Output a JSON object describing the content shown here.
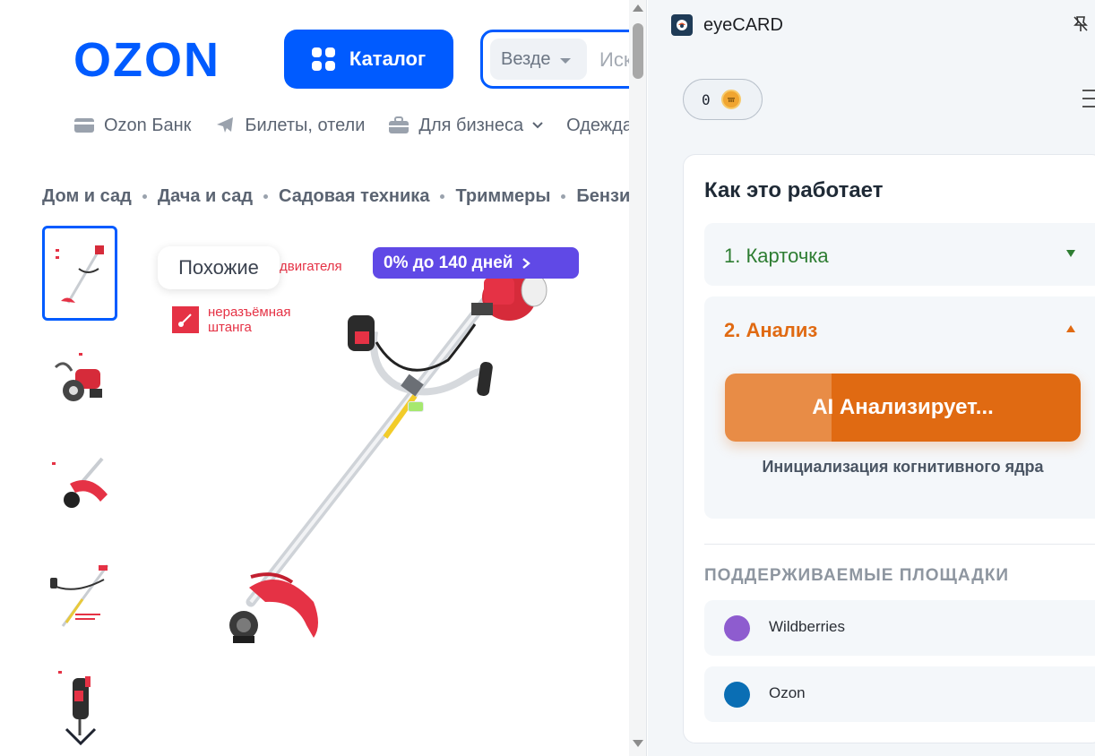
{
  "ozon": {
    "logo_text": "OZON",
    "catalog_label": "Каталог",
    "search": {
      "scope": "Везде",
      "placeholder": "Искать на Ozon"
    },
    "topnav": [
      "Ozon Банк",
      "Билеты, отели",
      "Для бизнеса",
      "Одежда"
    ],
    "breadcrumbs": [
      "Дом и сад",
      "Дача и сад",
      "Садовая техника",
      "Триммеры",
      "Бензиновые триммеры"
    ],
    "similar_label": "Похожие",
    "installment_label": "0% до 140 дней",
    "feature_1": "двигателя",
    "feature_2_line1": "неразъёмная",
    "feature_2_line2": "штанга",
    "brand_color": "#005bff",
    "installment_color": "#6049e6"
  },
  "panel": {
    "app_title": "eyeCARD",
    "coins": "0",
    "section_title": "Как это работает",
    "step1_label": "1. Карточка",
    "step2_label": "2. Анализ",
    "ai_button_label": "AI Анализирует...",
    "status_text": "Инициализация когнитивного ядра",
    "supported_title": "ПОДДЕРЖИВАЕМЫЕ ПЛОЩАДКИ",
    "sites": [
      {
        "name": "Wildberries",
        "color": "#8e5ccf"
      },
      {
        "name": "Ozon",
        "color": "#0a6eb4"
      }
    ],
    "accent_color": "#e06a12",
    "success_color": "#2e7d32"
  }
}
